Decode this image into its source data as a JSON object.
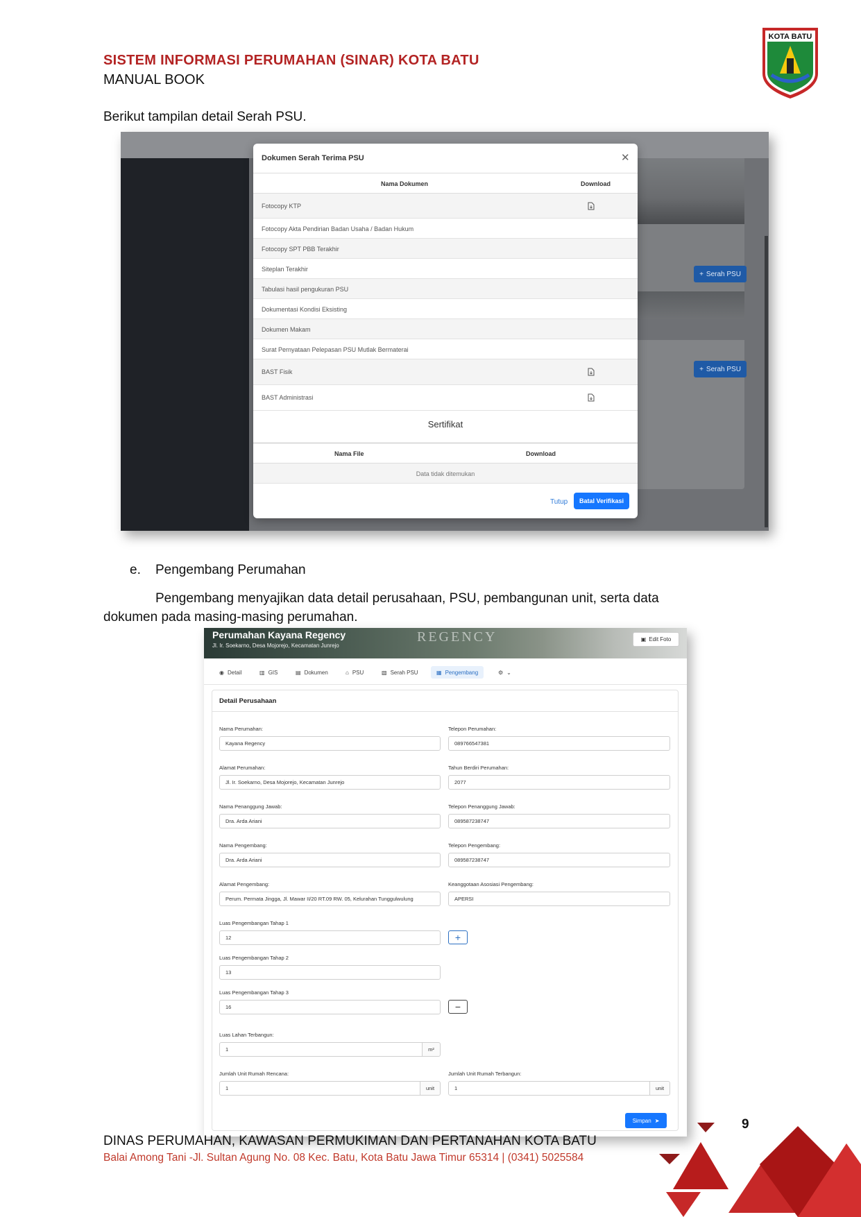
{
  "header": {
    "title": "SISTEM INFORMASI PERUMAHAN (SINAR) KOTA BATU",
    "subtitle": "MANUAL BOOK",
    "logo_text": "KOTA BATU"
  },
  "intro_text": "Berikut tampilan detail Serah PSU.",
  "screenshot1": {
    "modal_title": "Dokumen Serah Terima PSU",
    "col_name": "Nama Dokumen",
    "col_download": "Download",
    "rows": [
      "Fotocopy KTP",
      "Fotocopy Akta Pendirian Badan Usaha / Badan Hukum",
      "Fotocopy SPT PBB Terakhir",
      "Siteplan Terakhir",
      "Tabulasi hasil pengukuran PSU",
      "Dokumentasi Kondisi Eksisting",
      "Dokumen Makam",
      "Surat Pernyataan Pelepasan PSU Mutlak Bermaterai",
      "BAST Fisik",
      "BAST Administrasi"
    ],
    "certificate_heading": "Sertifikat",
    "cert_col_file": "Nama File",
    "cert_col_download": "Download",
    "cert_empty": "Data tidak ditemukan",
    "close_label": "Tutup",
    "cancel_verify_label": "Batal Verifikasi",
    "bg_button_label": "Serah PSU"
  },
  "section_e": {
    "letter": "e.",
    "heading": "Pengembang Perumahan",
    "para_line1": "Pengembang menyajikan data detail perusahaan, PSU, pembangunan unit, serta data",
    "para_line2": "dokumen pada masing-masing perumahan."
  },
  "screenshot2": {
    "banner_title": "Perumahan Kayana Regency",
    "banner_address": "Jl. Ir. Soekarno, Desa Mojorejo, Kecamatan Junrejo",
    "banner_sign": "REGENCY",
    "edit_photo": "Edit Foto",
    "tabs": [
      "Detail",
      "GIS",
      "Dokumen",
      "PSU",
      "Serah PSU",
      "Pengembang"
    ],
    "panel_title": "Detail Perusahaan",
    "fields": {
      "nama_perumahan_label": "Nama Perumahan:",
      "nama_perumahan": "Kayana Regency",
      "telepon_perumahan_label": "Telepon Perumahan:",
      "telepon_perumahan": "089766547381",
      "alamat_perumahan_label": "Alamat Perumahan:",
      "alamat_perumahan": "Jl. Ir. Soekarno, Desa Mojorejo, Kecamatan Junrejo",
      "tahun_berdiri_label": "Tahun Berdiri Perumahan:",
      "tahun_berdiri": "2077",
      "penanggung_jawab_label": "Nama Penanggung Jawab:",
      "penanggung_jawab": "Dra. Arda Ariani",
      "telepon_pj_label": "Telepon Penanggung Jawab:",
      "telepon_pj": "089587238747",
      "nama_pengembang_label": "Nama Pengembang:",
      "nama_pengembang": "Dra. Arda Ariani",
      "telepon_pengembang_label": "Telepon Pengembang:",
      "telepon_pengembang": "089587238747",
      "alamat_pengembang_label": "Alamat Pengembang:",
      "alamat_pengembang": "Perum. Permata Jingga, Jl. Mawar II/20 RT.09 RW. 05, Kelurahan Tunggulwulung",
      "asosiasi_label": "Keanggotaan Asosiasi Pengembang:",
      "asosiasi": "APERSI",
      "tahap1_label": "Luas Pengembangan Tahap 1",
      "tahap1": "12",
      "tahap2_label": "Luas Pengembangan Tahap 2",
      "tahap2": "13",
      "tahap3_label": "Luas Pengembangan Tahap 3",
      "tahap3": "16",
      "luas_lahan_label": "Luas Lahan Terbangun:",
      "luas_lahan": "1",
      "luas_lahan_unit": "m²",
      "unit_rencana_label": "Jumlah Unit Rumah Rencana:",
      "unit_rencana": "1",
      "unit_rencana_unit": "unit",
      "unit_terbangun_label": "Jumlah Unit Rumah Terbangun:",
      "unit_terbangun": "1",
      "unit_terbangun_unit": "unit"
    },
    "save_label": "Simpan"
  },
  "footer": {
    "page_number": "9",
    "org": "DINAS PERUMAHAN, KAWASAN PERMUKIMAN DAN PERTANAHAN KOTA BATU",
    "address": "Balai Among Tani -Jl. Sultan Agung No. 08 Kec. Batu, Kota Batu Jawa Timur 65314 | (0341) 5025584"
  },
  "colors": {
    "accent_red": "#b32323",
    "primary_blue": "#1677ff",
    "footer_red": "#c0392b"
  }
}
